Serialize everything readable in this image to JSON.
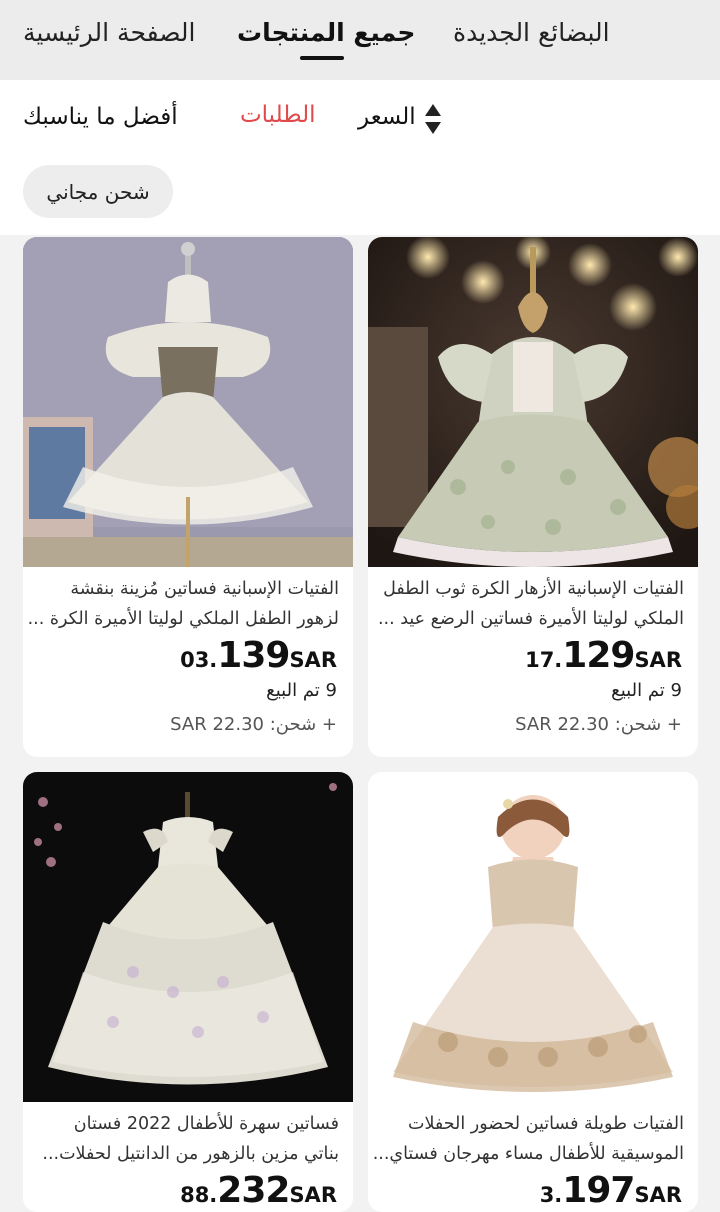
{
  "tabs": [
    {
      "label": "الصفحة الرئيسية"
    },
    {
      "label": "جميع المنتجات"
    },
    {
      "label": "البضائع الجديدة"
    }
  ],
  "filters": {
    "best_match": "أفضل ما يناسبك",
    "orders": "الطلبات",
    "price": "السعر",
    "free_shipping": "شحن مجاني"
  },
  "products": [
    {
      "title_line1": "الفتيات الإسبانية الأزهار الكرة ثوب الطفل",
      "title_line2": "الملكي لوليتا الأميرة فساتين الرضع عيد ...",
      "price_currency": "SAR",
      "price_int": "129",
      "price_dec": "17.",
      "sold": "9 تم البيع",
      "shipping": "+ شحن: SAR 22.30"
    },
    {
      "title_line1": "الفتيات الإسبانية فساتين مُزينة بنقشة",
      "title_line2": "لزهور الطفل الملكي لوليتا الأميرة الكرة ...",
      "price_currency": "SAR",
      "price_int": "139",
      "price_dec": "03.",
      "sold": "9 تم البيع",
      "shipping": "+ شحن: SAR 22.30"
    },
    {
      "title_line1": "الفتيات طويلة فساتين لحضور الحفلات",
      "title_line2": "الموسيقية للأطفال مساء مهرجان فستاي...",
      "price_currency": "SAR",
      "price_int": "197",
      "price_dec": "3."
    },
    {
      "title_line1": "فساتين سهرة للأطفال 2022 فستان",
      "title_line2": "بناتي مزين بالزهور من الدانتيل لحفلات...",
      "price_currency": "SAR",
      "price_int": "232",
      "price_dec": "88."
    }
  ],
  "colors": {
    "accent_red": "#e04a4a"
  }
}
